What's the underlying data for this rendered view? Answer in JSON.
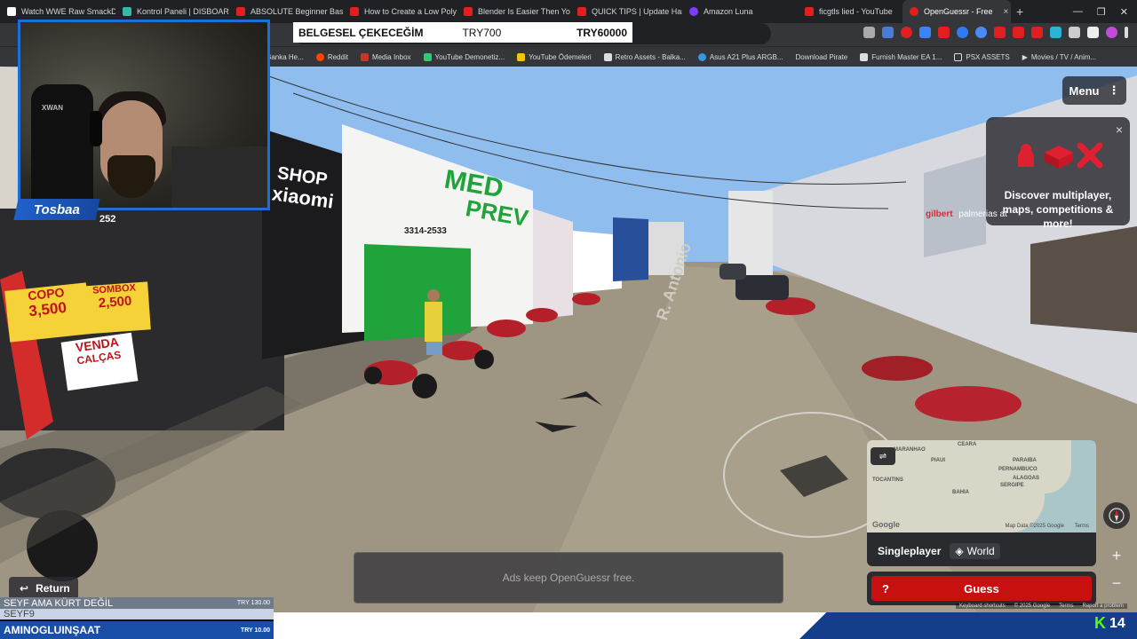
{
  "browser": {
    "tabs": [
      {
        "label": "Watch WWE Raw SmackD",
        "color": "#ffffff"
      },
      {
        "label": "Kontrol Paneli | DISBOARD",
        "color": "#37b7a8"
      },
      {
        "label": "ABSOLUTE Beginner Basic",
        "color": "#e02020"
      },
      {
        "label": "How to Create a Low Poly",
        "color": "#e02020"
      },
      {
        "label": "Blender Is Easier Then You",
        "color": "#e02020"
      },
      {
        "label": "QUICK TIPS | Update Hand",
        "color": "#e02020"
      },
      {
        "label": "Amazon Luna",
        "color": "#7a3cff"
      },
      {
        "label": "ficgtls lied - YouTube",
        "color": "#e02020"
      },
      {
        "label": "OpenGuessr - Free",
        "color": "#e02020"
      }
    ],
    "active_tab_close": "×",
    "new_tab": "+",
    "window_controls": [
      "—",
      "❐",
      "✕"
    ]
  },
  "bookmarks": [
    {
      "label": "Banka He...",
      "color": "#888"
    },
    {
      "label": "Reddit",
      "color": "#ff4500"
    },
    {
      "label": "Media Inbox",
      "color": "#c0392b"
    },
    {
      "label": "YouTube Demonetiz...",
      "color": "#2ecc71"
    },
    {
      "label": "YouTube Ödemeleri",
      "color": "#f1c40f"
    },
    {
      "label": "Retro Assets - Balka...",
      "color": "#ddd"
    },
    {
      "label": "Asus A21 Plus ARGB...",
      "color": "#3498db"
    },
    {
      "label": "Download Pirate",
      "color": "#aaa"
    },
    {
      "label": "Furnish Master EA 1...",
      "color": "#ddd"
    },
    {
      "label": "PSX ASSETS",
      "color": "#ddd"
    },
    {
      "label": "Movies / TV / Anim...",
      "color": "#ddd"
    }
  ],
  "donation_banner": {
    "text": "BELGESEL ÇEKECEĞİM",
    "amount_current": "TRY700",
    "amount_goal": "TRY60000"
  },
  "streamer": {
    "name": "Tosbaa",
    "chair_text": "XWAN"
  },
  "street_signs": {
    "shop": "SHOP",
    "xiaomi": "xiaomi",
    "number": "252",
    "med": "MED",
    "prev": "PREV",
    "phone": "3314-2533",
    "street": "R. Antonio",
    "promo1": "COPO",
    "promo1_price": "3,500",
    "promo2": "SOMBOX",
    "promo2_price": "2,500",
    "promo3": "VENDA",
    "promo3_sub": "CALÇAS"
  },
  "menu": {
    "label": "Menu",
    "icon": "⋮"
  },
  "promo": {
    "close": "×",
    "text": "Discover multiplayer, maps, competitions & more!"
  },
  "place_label": {
    "part1": "gilbert",
    "part2": "palmerias at"
  },
  "minimap": {
    "labels": [
      "CEARA",
      "MARANHAO",
      "PIAUI",
      "PARAIBA",
      "PERNAMBUCO",
      "TOCANTINS",
      "ALAGOAS",
      "SERGIPE",
      "BAHIA"
    ],
    "attribution": "Map Data ©2025 Google",
    "terms": "Terms",
    "google": "Google",
    "mode": "Singleplayer",
    "world": "World"
  },
  "guess": {
    "label": "Guess",
    "help": "?"
  },
  "zoom": {
    "plus": "+",
    "minus": "−"
  },
  "footer_links": [
    "Keyboard shortcuts",
    "© 2025 Google",
    "Terms",
    "Report a problem"
  ],
  "return": {
    "label": "Return",
    "icon": "↩"
  },
  "ad": {
    "text": "Ads keep OpenGuessr free."
  },
  "ticker": [
    {
      "name": "SEYF AMA KÜRT DEĞİL",
      "amount": "TRY 130.00"
    },
    {
      "name": "SEYF9",
      "amount": ""
    },
    {
      "name": "AMINOGLUINŞAAT",
      "amount": "TRY 10.00"
    }
  ],
  "kick": {
    "logo": "K",
    "count": "14"
  },
  "colors": {
    "accent_blue": "#1b6fd6",
    "guess_red": "#c81010",
    "kick_green": "#53fc18"
  }
}
